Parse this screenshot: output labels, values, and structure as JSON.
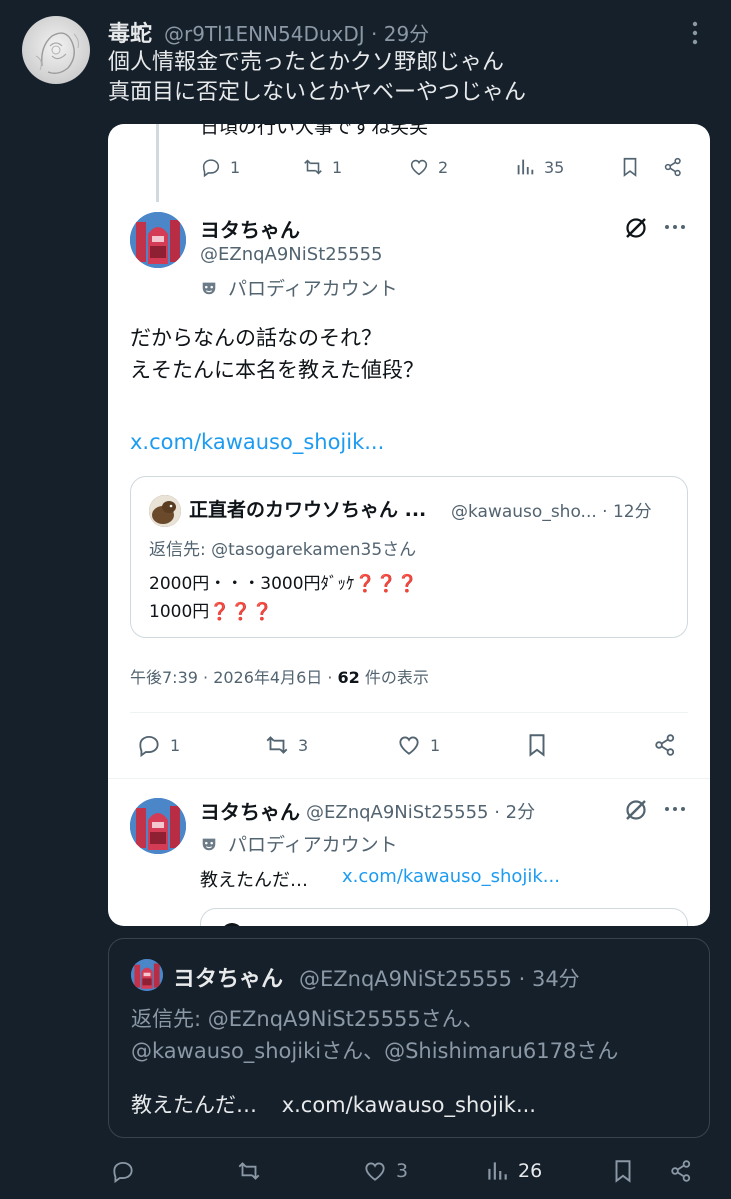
{
  "outer_tweet": {
    "name": "毒蛇",
    "handle_time": "@r9Tl1ENN54DuxDJ · 29分",
    "text_line1": "個人情報金で売ったとかクソ野郎じゃん",
    "text_line2": "真面目に否定しないとかヤベーやつじゃん",
    "more_icon": "more-vertical-icon"
  },
  "card": {
    "cut_text": "日頃の行い大事ですね笑笑",
    "top_actions": {
      "replies": "1",
      "retweets": "1",
      "likes": "2",
      "views": "35"
    },
    "main_post": {
      "name": "ヨタちゃん",
      "handle": "@EZnqA9NiSt25555",
      "parody_label": "パロディアカウント",
      "text_line1": "だからなんの話なのそれ？",
      "text_line2": "えそたんに本名を教えた値段？",
      "link": "x.com/kawauso_shojik...",
      "quote": {
        "name": "正直者のカワウソちゃん ...",
        "meta": "@kawauso_sho... · 12分",
        "reply_to": "返信先: @tasogarekamen35さん",
        "line1": "2000円・・・3000円ﾀﾞｯｹ",
        "line1_marks": "❓❓❓",
        "line2": "1000円",
        "line2_marks": "❓❓❓"
      },
      "timestamp": "午後7:39 · 2026年4月6日 · ",
      "view_count": "62",
      "view_suffix": " 件の表示",
      "actions": {
        "replies": "1",
        "retweets": "3",
        "likes": "1"
      }
    },
    "reply_post": {
      "name": "ヨタちゃん",
      "handle_time": "@EZnqA9NiSt25555 · 2分",
      "parody_label": "パロディアカウント",
      "text": "教えたんだ…",
      "link": "x.com/kawauso_shojik..."
    }
  },
  "quoted_tweet": {
    "name": "ヨタちゃん",
    "handle_time": "@EZnqA9NiSt25555 · 34分",
    "reply_line1": "返信先: @EZnqA9NiSt25555さん、",
    "reply_line2": "@kawauso_shojikiさん、@Shishimaru6178さん",
    "text": "教えたんだ…",
    "link": "x.com/kawauso_shojik..."
  },
  "bottom_actions": {
    "replies": "",
    "retweets": "",
    "likes": "3",
    "views": "26"
  },
  "colors": {
    "background": "#15202b",
    "link": "#1d9bf0",
    "card": "#ffffff",
    "muted": "#8b98a5"
  }
}
